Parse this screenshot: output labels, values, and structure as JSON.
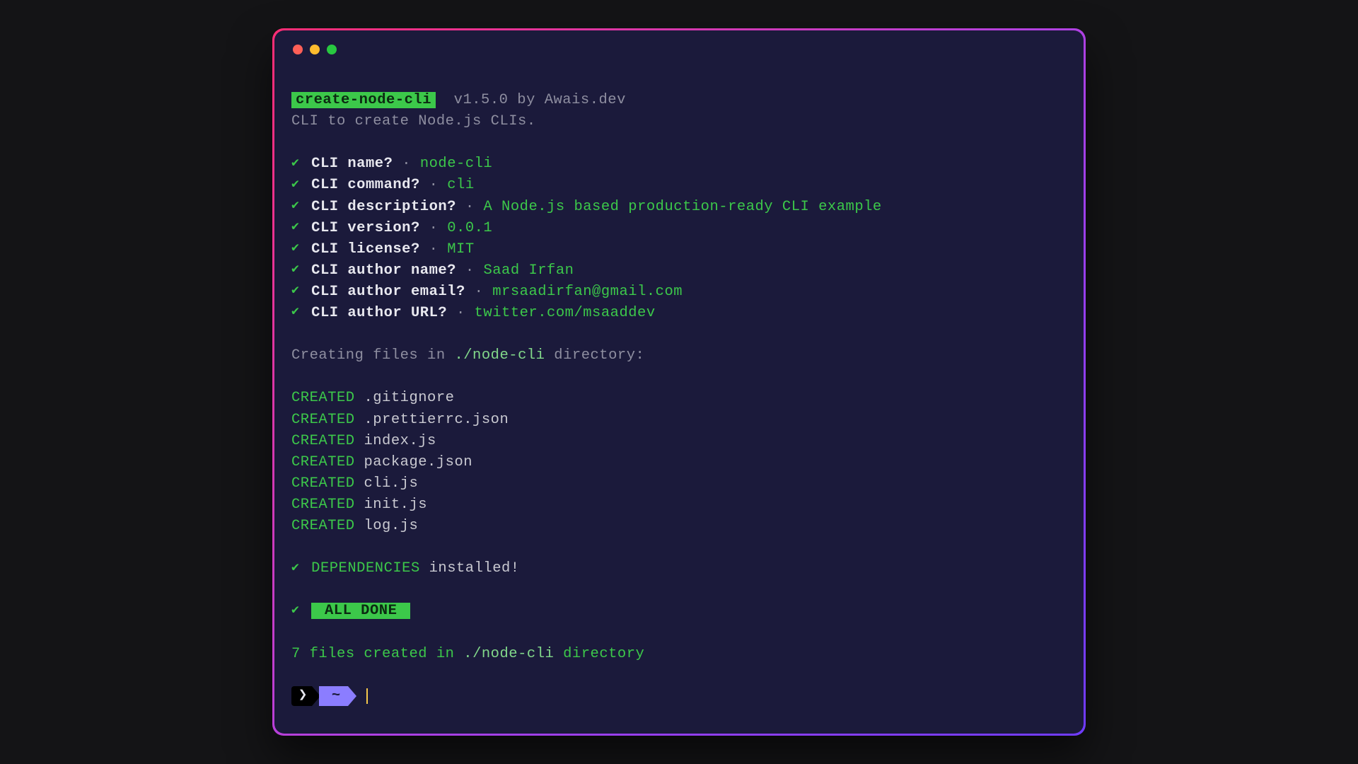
{
  "header": {
    "badge": "create-node-cli",
    "version": "v1.5.0",
    "by_prefix": "by",
    "author": "Awais.dev",
    "tagline": "CLI to create Node.js CLIs."
  },
  "separator": "·",
  "prompts": [
    {
      "question": "CLI name?",
      "answer": "node-cli"
    },
    {
      "question": "CLI command?",
      "answer": "cli"
    },
    {
      "question": "CLI description?",
      "answer": "A Node.js based production-ready CLI example"
    },
    {
      "question": "CLI version?",
      "answer": "0.0.1"
    },
    {
      "question": "CLI license?",
      "answer": "MIT"
    },
    {
      "question": "CLI author name?",
      "answer": "Saad Irfan"
    },
    {
      "question": "CLI author email?",
      "answer": "mrsaadirfan@gmail.com"
    },
    {
      "question": "CLI author URL?",
      "answer": "twitter.com/msaaddev"
    }
  ],
  "creating": {
    "prefix": "Creating files in",
    "path": "./node-cli",
    "suffix": "directory:"
  },
  "created_label": "CREATED",
  "created": [
    ".gitignore",
    ".prettierrc.json",
    "index.js",
    "package.json",
    "cli.js",
    "init.js",
    "log.js"
  ],
  "deps": {
    "label": "DEPENDENCIES",
    "suffix": "installed!"
  },
  "done_badge": "ALL DONE",
  "summary": {
    "count": "7",
    "mid1": "files created in",
    "path": "./node-cli",
    "tail": "directory"
  },
  "shell": {
    "arrow": "❯",
    "cwd": "~"
  },
  "icons": {
    "check": "✔"
  }
}
